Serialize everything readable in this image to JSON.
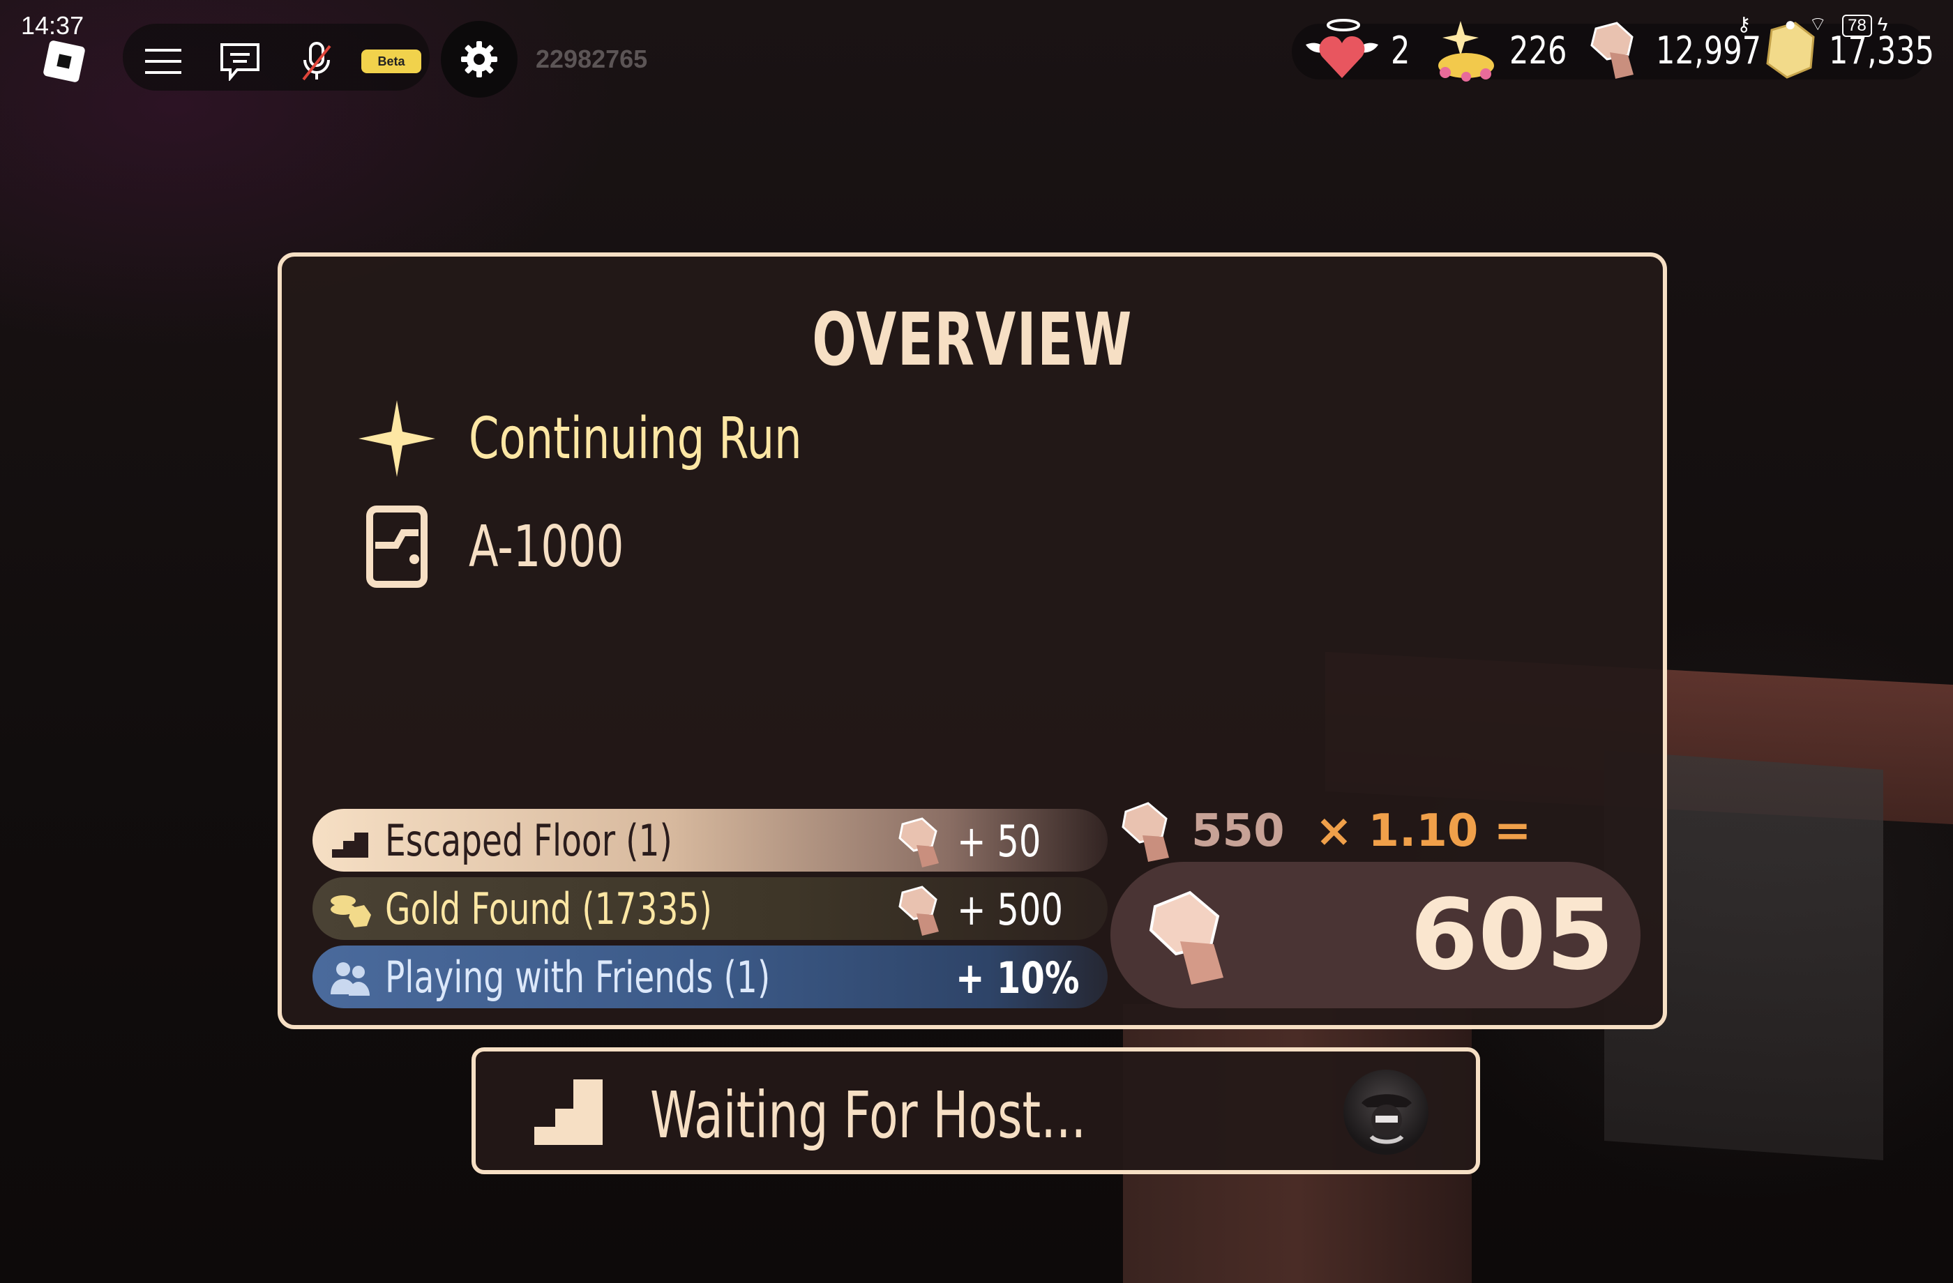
{
  "topbar": {
    "time": "14:37",
    "beta_label": "Beta",
    "user_id": "22982765"
  },
  "hud": {
    "revives": "2",
    "stardust": "226",
    "knobs": "12,997",
    "gold": "17,335",
    "battery": "78"
  },
  "overview": {
    "title": "OVERVIEW",
    "run_label": "Continuing Run",
    "floor_label": "A-1000"
  },
  "rewards": [
    {
      "label": "Escaped Floor (1)",
      "value": "+ 50"
    },
    {
      "label": "Gold Found (17335)",
      "value": "+ 500"
    },
    {
      "label": "Playing with Friends (1)",
      "value": "+ 10%"
    }
  ],
  "summary": {
    "base": "550",
    "multiplier": "× 1.10 =",
    "total": "605"
  },
  "wait": {
    "label": "Waiting For Host..."
  },
  "colors": {
    "accent_cream": "#f6dfc4",
    "gold": "#fde7a4",
    "orange": "#f0a04a",
    "friends_blue": "#3c5a88"
  }
}
